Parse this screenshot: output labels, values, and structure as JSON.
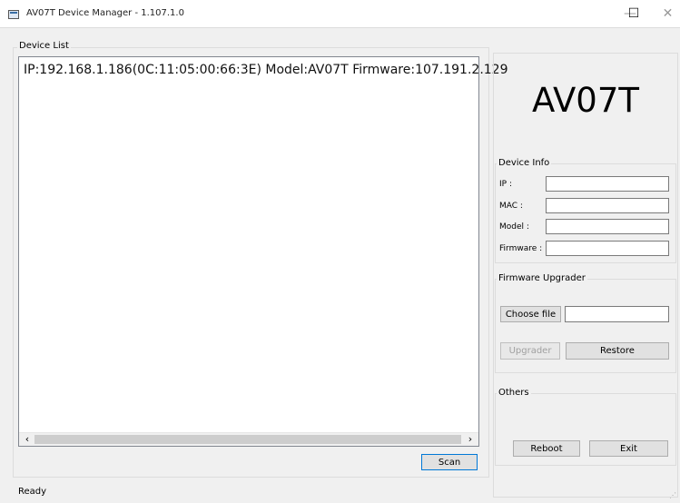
{
  "window": {
    "title": "AV07T Device Manager - 1.107.1.0",
    "min_glyph": "—",
    "max_glyph": "☐",
    "close_glyph": "✕",
    "icon": "app-window-icon"
  },
  "device_list": {
    "group_label": "Device List",
    "rows": [
      "IP:192.168.1.186(0C:11:05:00:66:3E)  Model:AV07T  Firmware:107.191.2.129"
    ],
    "scroll_left": "‹",
    "scroll_right": "›"
  },
  "scan_label": "Scan",
  "status_text": "Ready",
  "model_title": "AV07T",
  "device_info": {
    "group_label": "Device Info",
    "ip_label": "IP :",
    "mac_label": "MAC :",
    "model_label": "Model :",
    "firmware_label": "Firmware :",
    "ip_value": "",
    "mac_value": "",
    "model_value": "",
    "firmware_value": ""
  },
  "firmware_upgrader": {
    "group_label": "Firmware Upgrader",
    "choose_file_label": "Choose file",
    "file_path": "",
    "upgrader_label": "Upgrader",
    "restore_label": "Restore"
  },
  "others": {
    "group_label": "Others",
    "reboot_label": "Reboot",
    "exit_label": "Exit"
  }
}
